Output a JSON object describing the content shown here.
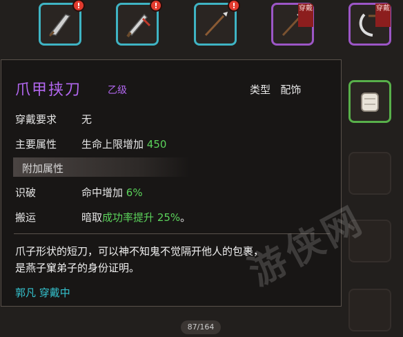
{
  "top_slots": [
    {
      "icon": "broad-sword-icon",
      "alert": "!"
    },
    {
      "icon": "serrated-sword-icon",
      "alert": "!"
    },
    {
      "icon": "spear-icon",
      "alert": "!"
    },
    {
      "icon": "halberd-icon",
      "equipped_tag": "穿戴"
    },
    {
      "icon": "hook-blade-icon",
      "equipped_tag": "穿戴"
    }
  ],
  "right_slot": {
    "icon": "gloves-icon"
  },
  "item": {
    "name": "爪甲挟刀",
    "grade": "乙级",
    "type_label": "类型",
    "type_value": "配饰",
    "req_label": "穿戴要求",
    "req_value": "无",
    "main_attr_label": "主要属性",
    "main_attr_text": "生命上限增加",
    "main_attr_value": "450",
    "extra_header": "附加属性",
    "attr1_label": "识破",
    "attr1_text": "命中增加",
    "attr1_value": "6%",
    "attr2_label": "搬运",
    "attr2_prefix": "暗取",
    "attr2_text": "成功率提升",
    "attr2_value": "25%",
    "attr2_suffix": "。",
    "desc_line1": "爪子形状的短刀，可以神不知鬼不觉隔开他人的包裹，",
    "desc_line2": "是燕子窠弟子的身份证明。",
    "owner": "郭凡 穿戴中"
  },
  "pager": "87/164",
  "watermark": "游侠网"
}
